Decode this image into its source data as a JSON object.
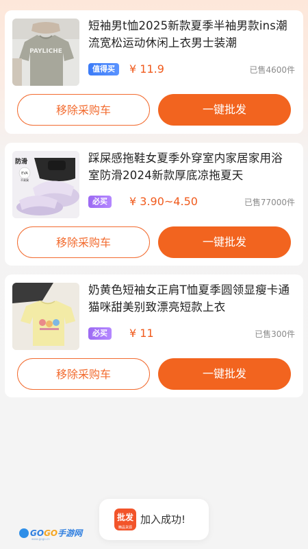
{
  "products": [
    {
      "title": "短袖男t恤2025新款夏季半袖男款ins潮流宽松运动休闲上衣男士装潮",
      "badge": "值得买",
      "badge_color": "#3b7bf7",
      "price": "¥ 11.9",
      "sold": "已售4600件",
      "image_icon": "tshirt-product-photo",
      "image_print": "PAYLICHE",
      "remove_label": "移除采购车",
      "batch_label": "一键批发"
    },
    {
      "title": "踩屎感拖鞋女夏季外穿室内家居家用浴室防滑2024新款厚底凉拖夏天",
      "badge": "必买",
      "badge_color": "#9c6af2",
      "price": "¥ 3.90~4.50",
      "sold": "已售77000件",
      "image_icon": "slippers-product-photo",
      "image_tag": "防滑",
      "image_tag2": "EVA",
      "image_tag3": "不易臭",
      "remove_label": "移除采购车",
      "batch_label": "一键批发"
    },
    {
      "title": "奶黄色短袖女正肩T恤夏季圆领显瘦卡通猫咪甜美别致漂亮短款上衣",
      "badge": "必买",
      "badge_color": "#9c6af2",
      "price": "¥ 11",
      "sold": "已售300件",
      "image_icon": "yellow-tshirt-product-photo",
      "remove_label": "移除采购车",
      "batch_label": "一键批发"
    }
  ],
  "toast": {
    "icon_label": "批发",
    "icon_sub": "精品货源",
    "message": "加入成功!"
  },
  "watermark": {
    "brand_a": "GO",
    "brand_b": "GO",
    "brand_c": "手游网",
    "url": "www.gogo.cn"
  },
  "colors": {
    "accent": "#f2641f",
    "price": "#f05a1c",
    "badge_blue": "#3b7bf7",
    "badge_purple": "#9c6af2"
  }
}
